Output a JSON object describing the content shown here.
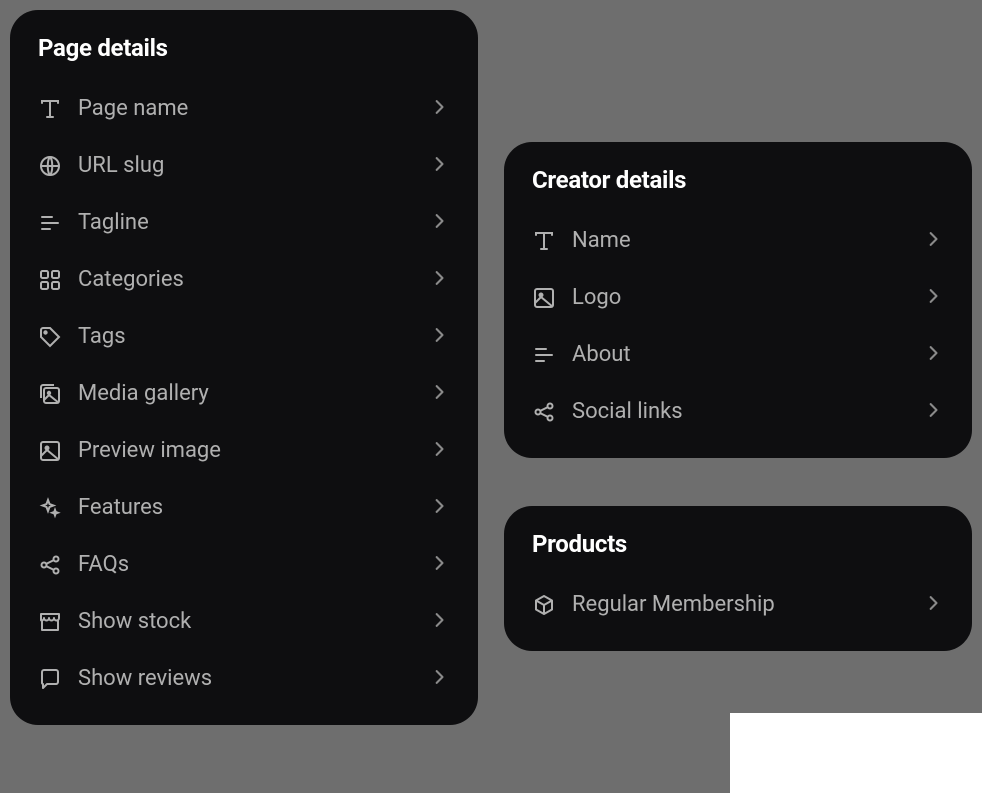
{
  "panels": {
    "pageDetails": {
      "title": "Page details",
      "items": [
        {
          "label": "Page name",
          "icon": "type-icon"
        },
        {
          "label": "URL slug",
          "icon": "globe-icon"
        },
        {
          "label": "Tagline",
          "icon": "lines-icon"
        },
        {
          "label": "Categories",
          "icon": "grid-icon"
        },
        {
          "label": "Tags",
          "icon": "tag-icon"
        },
        {
          "label": "Media gallery",
          "icon": "gallery-icon"
        },
        {
          "label": "Preview image",
          "icon": "image-icon"
        },
        {
          "label": "Features",
          "icon": "sparkle-icon"
        },
        {
          "label": "FAQs",
          "icon": "share-icon"
        },
        {
          "label": "Show stock",
          "icon": "storefront-icon"
        },
        {
          "label": "Show reviews",
          "icon": "chat-icon"
        }
      ]
    },
    "creatorDetails": {
      "title": "Creator details",
      "items": [
        {
          "label": "Name",
          "icon": "type-icon"
        },
        {
          "label": "Logo",
          "icon": "image-icon"
        },
        {
          "label": "About",
          "icon": "lines-icon"
        },
        {
          "label": "Social links",
          "icon": "share-icon"
        }
      ]
    },
    "products": {
      "title": "Products",
      "items": [
        {
          "label": "Regular Membership",
          "icon": "cube-icon"
        }
      ]
    }
  }
}
